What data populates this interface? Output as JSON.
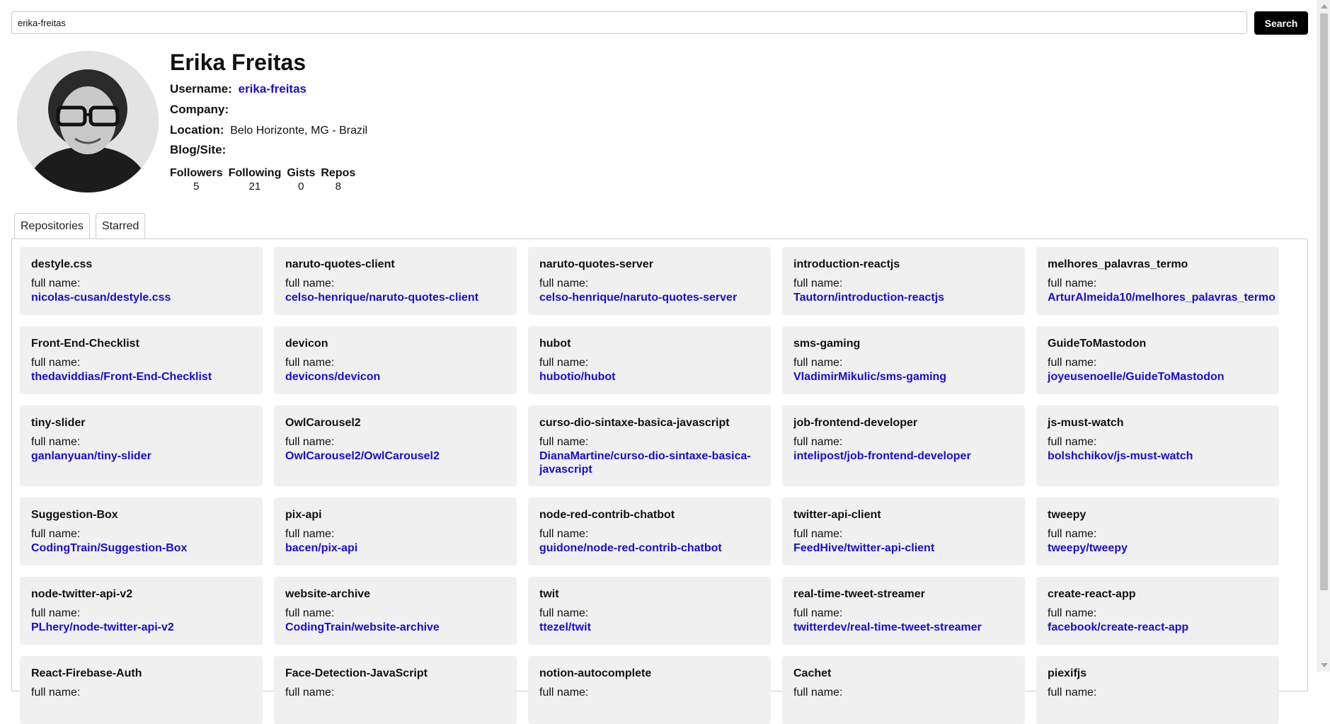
{
  "search": {
    "value": "erika-freitas",
    "button_label": "Search"
  },
  "profile": {
    "name": "Erika Freitas",
    "username_label": "Username:",
    "username": "erika-freitas",
    "company_label": "Company:",
    "company": "",
    "location_label": "Location:",
    "location": "Belo Horizonte, MG - Brazil",
    "blog_label": "Blog/Site:",
    "blog": ""
  },
  "stats": [
    {
      "label": "Followers",
      "value": "5"
    },
    {
      "label": "Following",
      "value": "21"
    },
    {
      "label": "Gists",
      "value": "0"
    },
    {
      "label": "Repos",
      "value": "8"
    }
  ],
  "tabs": [
    {
      "label": "Repositories"
    },
    {
      "label": "Starred"
    }
  ],
  "full_name_label": "full name:",
  "repos": [
    {
      "name": "destyle.css",
      "full_name": "nicolas-cusan/destyle.css"
    },
    {
      "name": "naruto-quotes-client",
      "full_name": "celso-henrique/naruto-quotes-client"
    },
    {
      "name": "naruto-quotes-server",
      "full_name": "celso-henrique/naruto-quotes-server"
    },
    {
      "name": "introduction-reactjs",
      "full_name": "Tautorn/introduction-reactjs"
    },
    {
      "name": "melhores_palavras_termo",
      "full_name": "ArturAlmeida10/melhores_palavras_termo"
    },
    {
      "name": "Front-End-Checklist",
      "full_name": "thedaviddias/Front-End-Checklist"
    },
    {
      "name": "devicon",
      "full_name": "devicons/devicon"
    },
    {
      "name": "hubot",
      "full_name": "hubotio/hubot"
    },
    {
      "name": "sms-gaming",
      "full_name": "VladimirMikulic/sms-gaming"
    },
    {
      "name": "GuideToMastodon",
      "full_name": "joyeusenoelle/GuideToMastodon"
    },
    {
      "name": "tiny-slider",
      "full_name": "ganlanyuan/tiny-slider"
    },
    {
      "name": "OwlCarousel2",
      "full_name": "OwlCarousel2/OwlCarousel2"
    },
    {
      "name": "curso-dio-sintaxe-basica-javascript",
      "full_name": "DianaMartine/curso-dio-sintaxe-basica-javascript"
    },
    {
      "name": "job-frontend-developer",
      "full_name": "intelipost/job-frontend-developer"
    },
    {
      "name": "js-must-watch",
      "full_name": "bolshchikov/js-must-watch"
    },
    {
      "name": "Suggestion-Box",
      "full_name": "CodingTrain/Suggestion-Box"
    },
    {
      "name": "pix-api",
      "full_name": "bacen/pix-api"
    },
    {
      "name": "node-red-contrib-chatbot",
      "full_name": "guidone/node-red-contrib-chatbot"
    },
    {
      "name": "twitter-api-client",
      "full_name": "FeedHive/twitter-api-client"
    },
    {
      "name": "tweepy",
      "full_name": "tweepy/tweepy"
    },
    {
      "name": "node-twitter-api-v2",
      "full_name": "PLhery/node-twitter-api-v2"
    },
    {
      "name": "website-archive",
      "full_name": "CodingTrain/website-archive"
    },
    {
      "name": "twit",
      "full_name": "ttezel/twit"
    },
    {
      "name": "real-time-tweet-streamer",
      "full_name": "twitterdev/real-time-tweet-streamer"
    },
    {
      "name": "create-react-app",
      "full_name": "facebook/create-react-app"
    },
    {
      "name": "React-Firebase-Auth",
      "full_name": ""
    },
    {
      "name": "Face-Detection-JavaScript",
      "full_name": ""
    },
    {
      "name": "notion-autocomplete",
      "full_name": ""
    },
    {
      "name": "Cachet",
      "full_name": ""
    },
    {
      "name": "piexifjs",
      "full_name": ""
    }
  ],
  "colors": {
    "link": "#1a0dcc",
    "card_bg": "#f0f0f0",
    "button_bg": "#000000"
  },
  "icons": {
    "avatar": "user-photo"
  }
}
